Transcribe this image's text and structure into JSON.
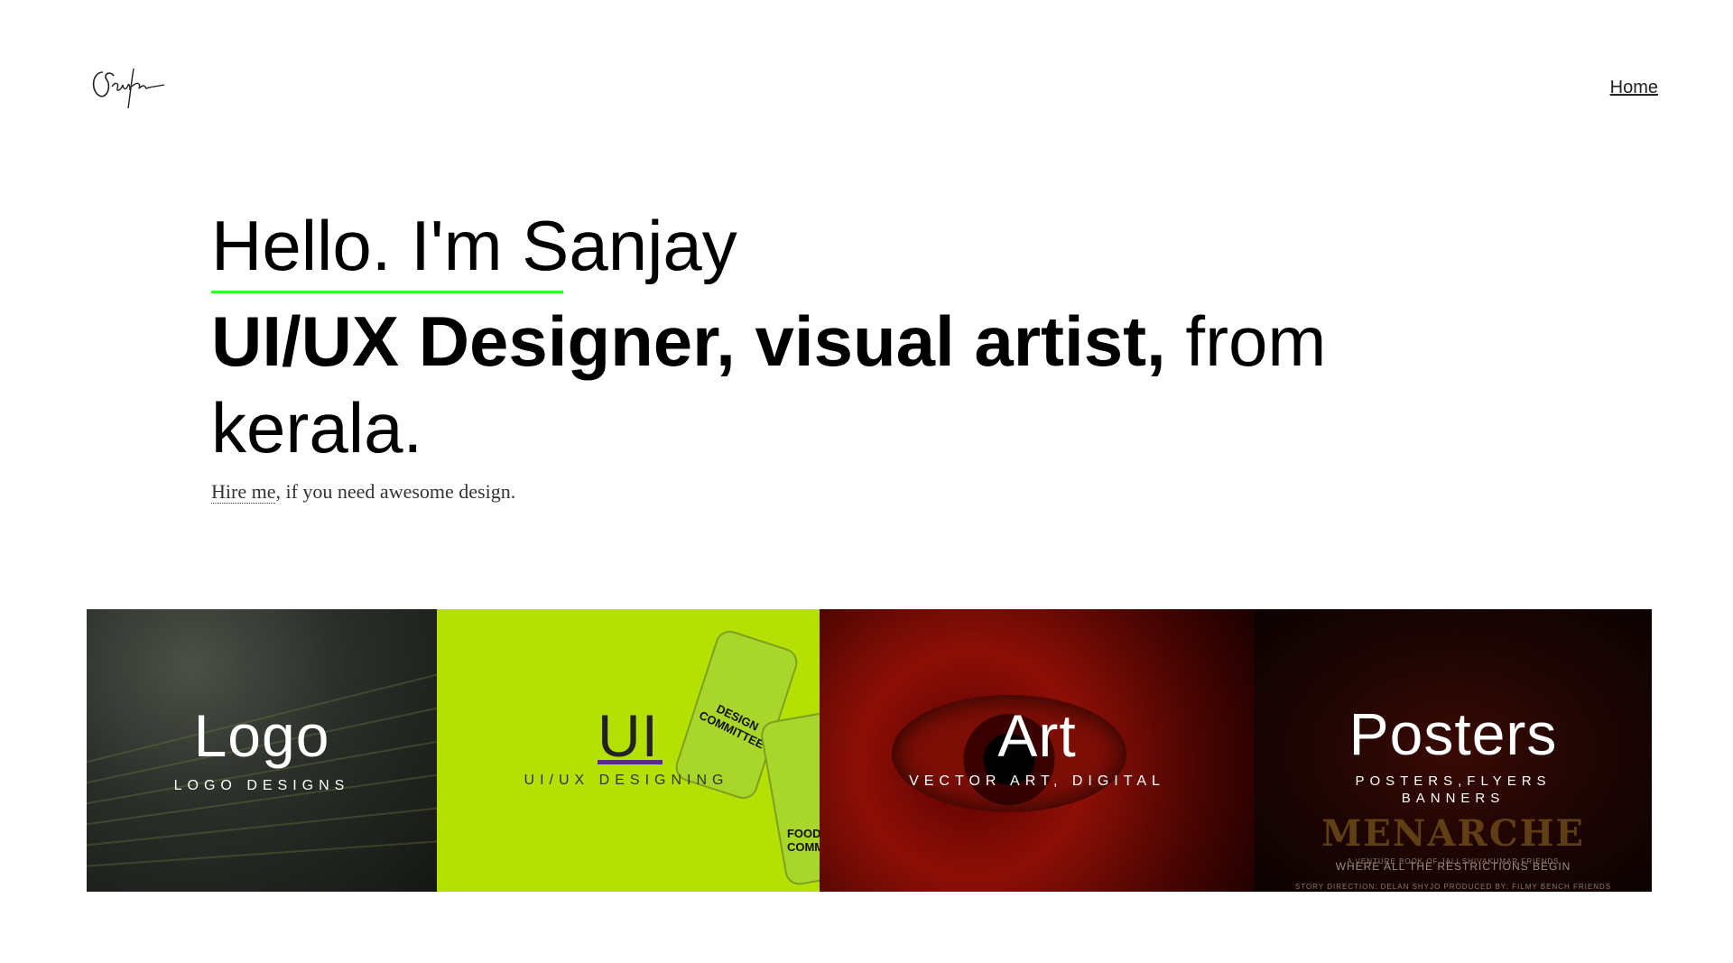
{
  "nav": {
    "home_label": "Home"
  },
  "hero": {
    "hello": "Hello. I'm Sanjay",
    "headline_bold": "UI/UX Designer, visual artist,",
    "headline_rest": " from kerala.",
    "hire_link": "Hire me",
    "hire_rest": ", if you need awesome design."
  },
  "tiles": [
    {
      "title": "Logo",
      "subtitle": "LOGO DESIGNS"
    },
    {
      "title": "UI",
      "subtitle": "UI/UX DESIGNING",
      "card_text_1": "DESIGN COMMITTEE",
      "card_text_2": "FOOD COMM"
    },
    {
      "title": "Art",
      "subtitle": "VECTOR ART, DIGITAL"
    },
    {
      "title": "Posters",
      "subtitle_1": "POSTERS,FLYERS",
      "subtitle_2": "BANNERS",
      "poster_title": "MENARCHE",
      "poster_tagline": "WHERE ALL THE RESTRICTIONS BEGIN",
      "poster_small_1": "A VENTURE BOOK OF JALI SHIVAKUMAR FRIENDS",
      "poster_small_2": "STORY DIRECTION: DELAN SHYJO  PRODUCED BY: FILMY BENCH FRIENDS"
    }
  ],
  "colors": {
    "accent_green": "#2cff2c",
    "ui_tile": "#b4e003",
    "ui_bar": "#5a2b8c",
    "art_tile": "#8d0f06",
    "poster_tile": "#1c0503"
  }
}
